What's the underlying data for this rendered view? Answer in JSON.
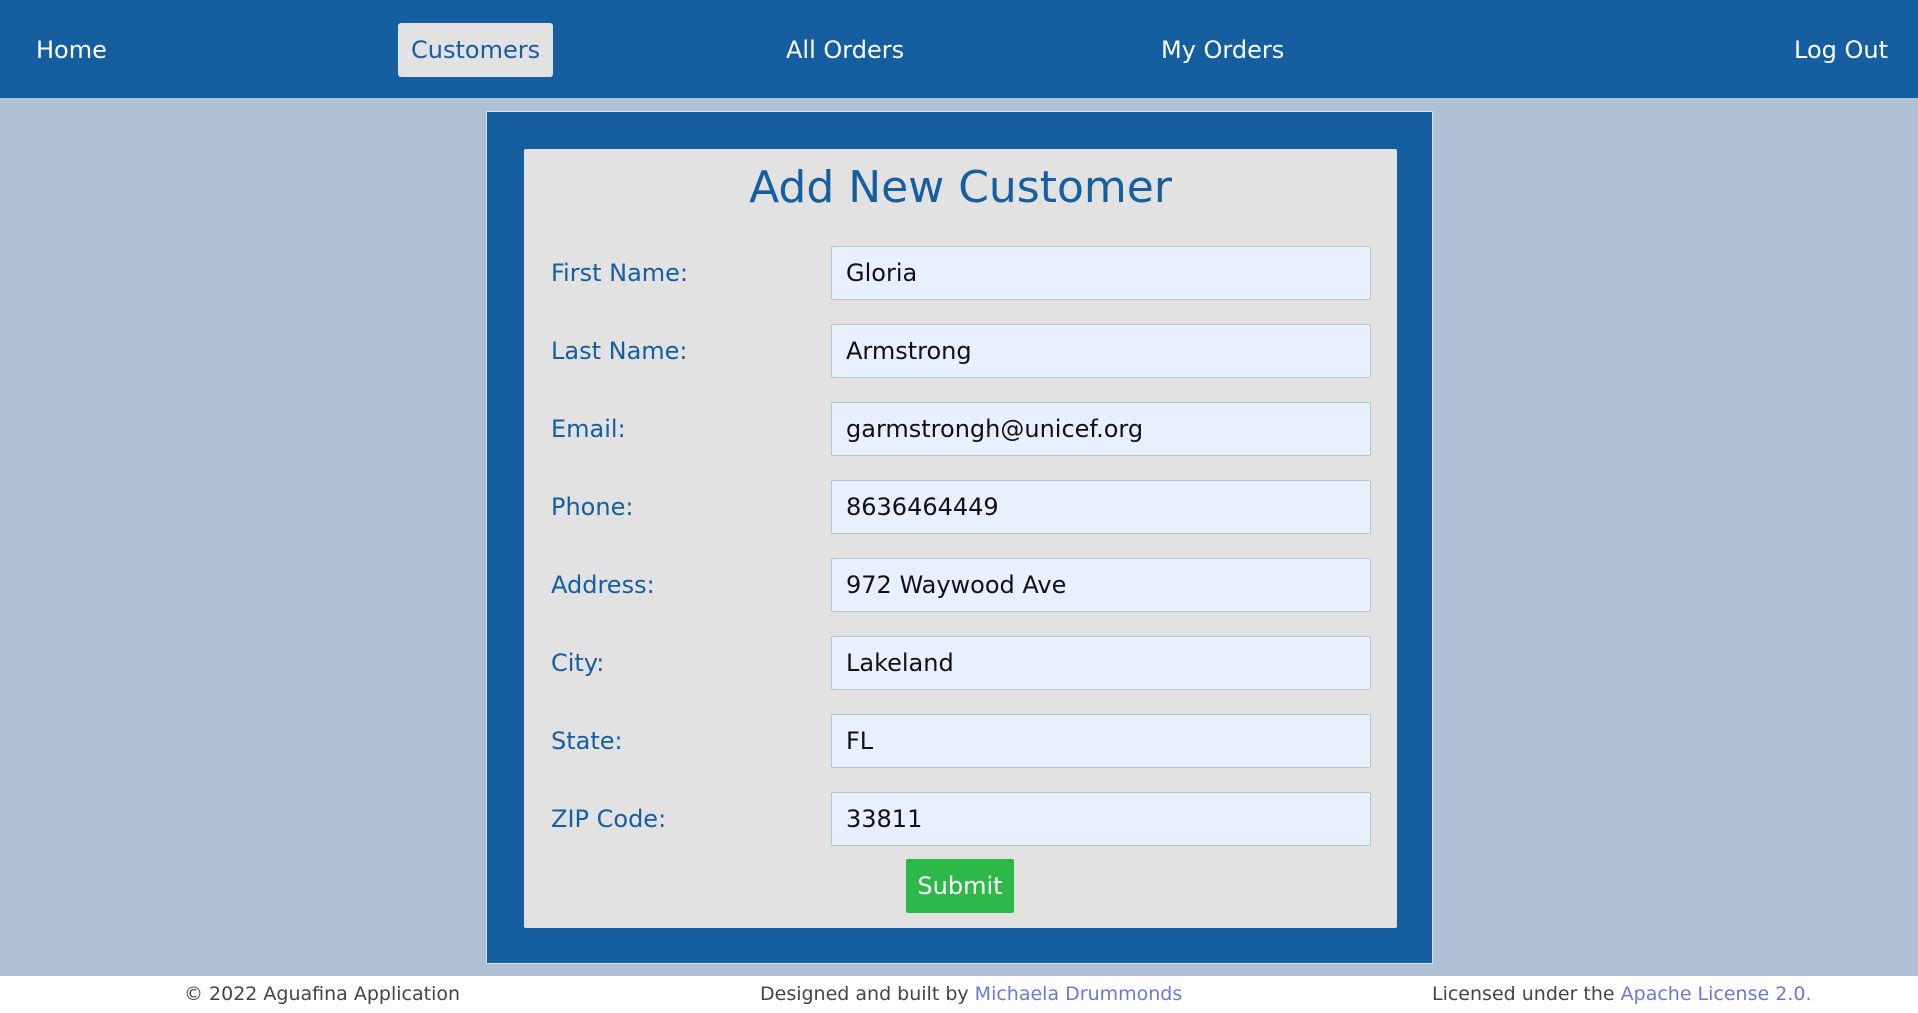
{
  "nav": {
    "home": "Home",
    "customers": "Customers",
    "all_orders": "All Orders",
    "my_orders": "My Orders",
    "log_out": "Log Out"
  },
  "form": {
    "title": "Add New Customer",
    "fields": [
      {
        "label": "First Name:",
        "value": "Gloria"
      },
      {
        "label": "Last Name:",
        "value": "Armstrong"
      },
      {
        "label": "Email:",
        "value": "garmstrongh@unicef.org"
      },
      {
        "label": "Phone:",
        "value": "8636464449"
      },
      {
        "label": "Address:",
        "value": "972 Waywood Ave"
      },
      {
        "label": "City:",
        "value": "Lakeland"
      },
      {
        "label": "State:",
        "value": "FL"
      },
      {
        "label": "ZIP Code:",
        "value": "33811"
      }
    ],
    "submit_label": "Submit"
  },
  "footer": {
    "copyright": "© 2022 Aguafina Application",
    "designed_prefix": "Designed and built by ",
    "designer_link": "Michaela Drummonds",
    "license_prefix": "Licensed under the ",
    "license_link": "Apache License 2.0."
  },
  "colors": {
    "brand_blue": "#155ea0",
    "panel_grey": "#e2e2e2",
    "page_background": "#afc0d4",
    "input_background": "#e8f0fe",
    "submit_green": "#2db84a",
    "link_color": "#6b78d6"
  }
}
